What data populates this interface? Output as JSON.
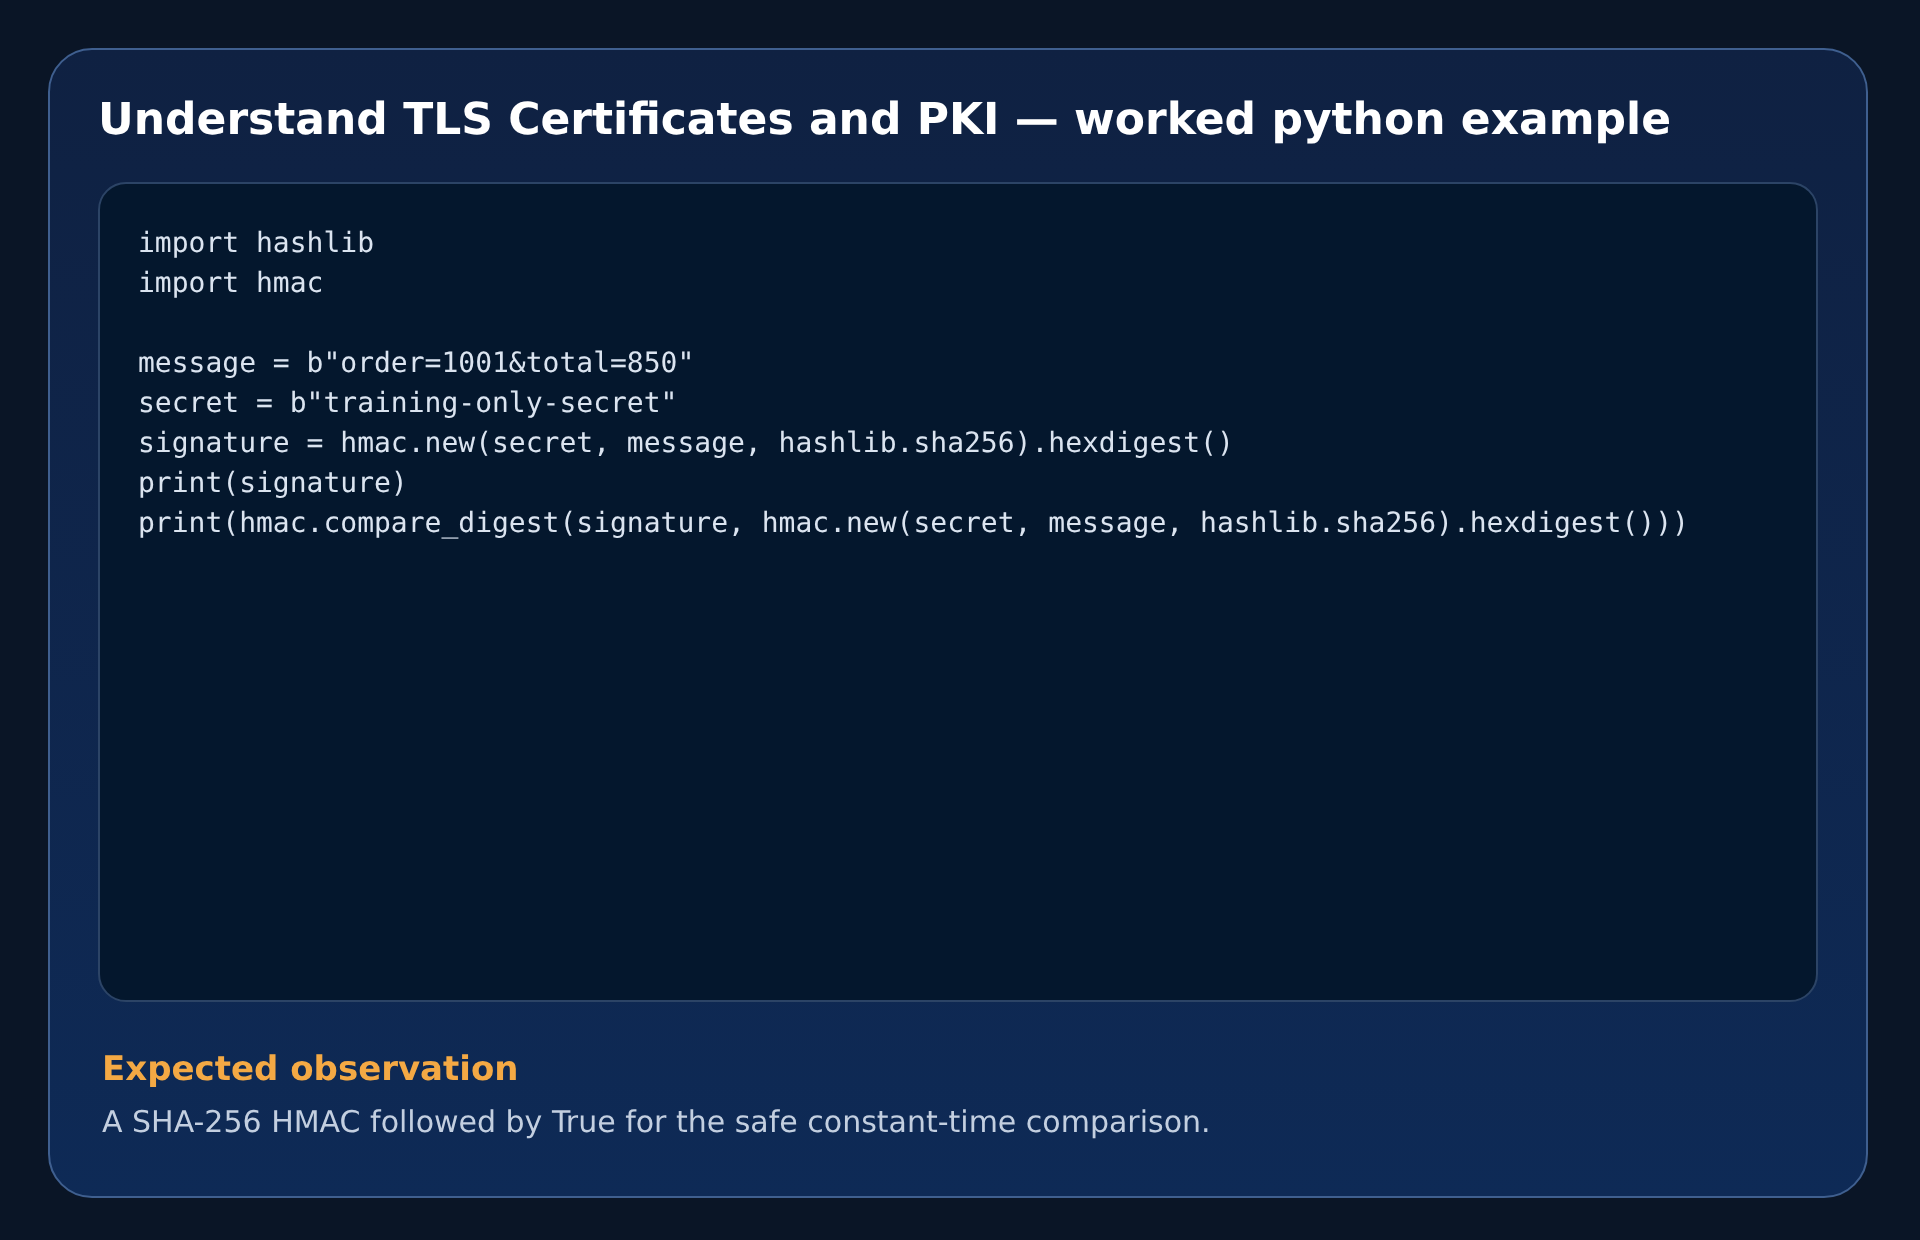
{
  "card": {
    "title": "Understand TLS Certificates and PKI — worked python example",
    "code": {
      "groups": [
        [
          "import hashlib",
          "import hmac"
        ],
        [
          "message = b\"order=1001&total=850\"",
          "secret = b\"training-only-secret\"",
          "signature = hmac.new(secret, message, hashlib.sha256).hexdigest()",
          "print(signature)",
          "print(hmac.compare_digest(signature, hmac.new(secret, message, hashlib.sha256).hexdigest()))"
        ]
      ]
    },
    "observation": {
      "heading": "Expected observation",
      "text": "A SHA-256 HMAC followed by True for the safe constant-time comparison."
    }
  }
}
